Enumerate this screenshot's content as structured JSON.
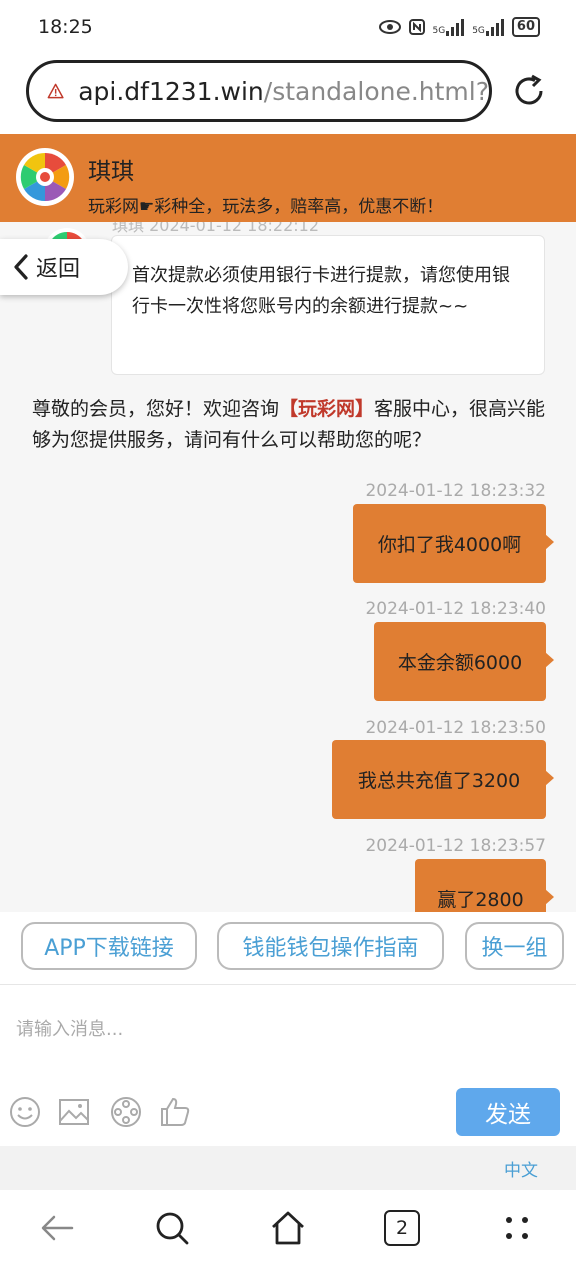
{
  "status_bar": {
    "time": "18:25",
    "signal1": "5G",
    "signal2": "5G",
    "battery": "60"
  },
  "browser": {
    "url_domain": "api.df1231.win",
    "url_path": "/standalone.html?"
  },
  "header": {
    "agent_name": "琪琪",
    "slogan": "玩彩网☛彩种全，玩法多，赔率高，优惠不断！",
    "color": "#e07e33"
  },
  "chat": {
    "partial_meta": "琪琪  2024-01-12 18:22:12",
    "notice": "首次提款必须使用银行卡进行提款，请您使用银行卡一次性将您账号内的余额进行提款~~",
    "back_label": "返回",
    "welcome_before": "尊敬的会员，您好！欢迎咨询",
    "welcome_brand": "【玩彩网】",
    "welcome_after": "客服中心，很高兴能够为您提供服务，请问有什么可以帮助您的呢？",
    "messages": [
      {
        "time": "2024-01-12 18:23:32",
        "text": "你扣了我4000啊"
      },
      {
        "time": "2024-01-12 18:23:40",
        "text": "本金余额6000"
      },
      {
        "time": "2024-01-12 18:23:50",
        "text": "我总共充值了3200"
      },
      {
        "time": "2024-01-12 18:23:57",
        "text": "赢了2800"
      }
    ]
  },
  "quick_buttons": [
    {
      "label": "APP下载链接"
    },
    {
      "label": "钱能钱包操作指南"
    },
    {
      "label": "换一组"
    }
  ],
  "composer": {
    "placeholder": "请输入消息...",
    "send_label": "发送",
    "tools": [
      "emoji-icon",
      "image-icon",
      "film-reel-icon",
      "thumbs-up-icon"
    ]
  },
  "language": "中文",
  "bottom_nav": {
    "tabs_count": "2",
    "icons": [
      "back-arrow-icon",
      "search-icon",
      "home-icon",
      "tabs-icon",
      "more-icon"
    ]
  },
  "accent_colors": {
    "orange": "#e07e33",
    "blue": "#5fa8ec",
    "link": "#4a9fd4"
  }
}
